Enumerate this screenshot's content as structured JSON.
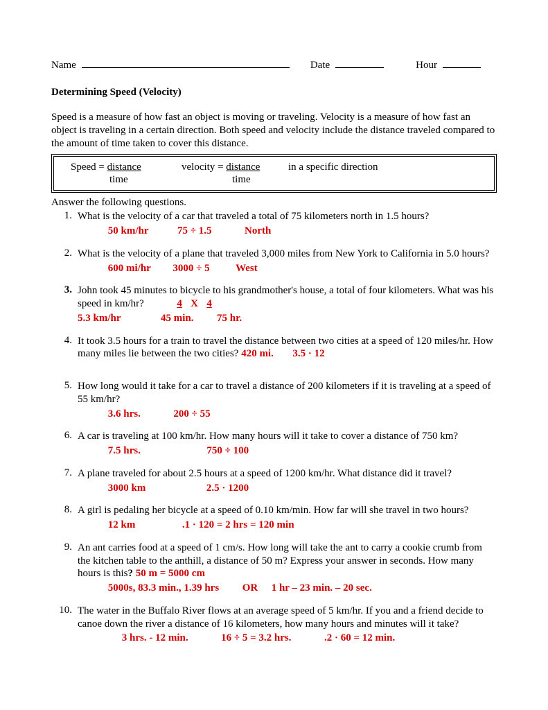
{
  "header": {
    "name_label": "Name",
    "date_label": "Date",
    "hour_label": "Hour"
  },
  "title": "Determining Speed (Velocity)",
  "intro": "Speed is a measure of how fast an object is moving or traveling.  Velocity is a measure of how fast an object is traveling in a certain direction.  Both speed and velocity include the distance traveled compared to the amount of time taken to cover this distance.",
  "formula": {
    "speed_label": "Speed = ",
    "speed_top": "distance",
    "speed_bot": "time",
    "vel_label": "velocity = ",
    "vel_top": "distance",
    "vel_bot": "time",
    "dir": "in a specific direction"
  },
  "answer_prompt": "Answer the following questions.",
  "q1": {
    "num": "1.",
    "text": "What is the velocity of a car that traveled a total of 75 kilometers north in 1.5 hours?",
    "a1": "50 km/hr",
    "a2": "75 ÷ 1.5",
    "a3": "North"
  },
  "q2": {
    "num": "2.",
    "text": "What is the velocity of a plane that traveled 3,000 miles from New York to California in 5.0 hours?",
    "a1": "600  mi/hr",
    "a2": "3000  ÷  5",
    "a3": "West"
  },
  "q3": {
    "num": "3.",
    "text1": "John took 45 minutes to bicycle to his grandmother's house, a total of four kilometers.  What was his speed in km/hr?",
    "a_top1": "4",
    "a_top2": "X",
    "a_top3": "4",
    "b1": "5.3 km/hr",
    "b2": "45 min.",
    "b3": "75 hr."
  },
  "q4": {
    "num": "4.",
    "text": "It took 3.5 hours for a train to travel the distance between two cities at a speed of 120 miles/hr.  How many miles lie between the two cities?",
    "a1": "420 mi.",
    "a2": "3.5  ·  12"
  },
  "q5": {
    "num": "5.",
    "text": "How long would it take for a car to travel a distance of 200 kilometers if it is traveling at a speed of 55 km/hr?",
    "a1": "3.6  hrs.",
    "a2": "200 ÷ 55"
  },
  "q6": {
    "num": "6.",
    "text": "A car is traveling at 100 km/hr.  How many hours will it take to cover a distance of 750 km?",
    "a1": "7.5 hrs.",
    "a2": "750 ÷ 100"
  },
  "q7": {
    "num": "7.",
    "text": "A plane traveled for about 2.5 hours at a speed of 1200 km/hr.  What distance did it travel?",
    "a1": "3000 km",
    "a2": "2.5  ·  1200"
  },
  "q8": {
    "num": "8.",
    "text": "A girl is pedaling her bicycle at a speed of 0.10 km/min.  How far will she travel in two hours?",
    "a1": "12 km",
    "a2": ".1  ·  120  =  2 hrs  =  120 min"
  },
  "q9": {
    "num": "9.",
    "text1": "An ant carries food at a speed of 1 cm/s.  How long will take the ant to carry a cookie crumb from the kitchen table to the anthill, a distance of 50 m?  Express your answer in seconds.  How many hours is this",
    "qm": "?  ",
    "a0": "50 m  =  5000 cm",
    "a1": "5000s,   83.3 min.,   1.39 hrs",
    "or": "OR",
    "a2": "1 hr – 23 min. – 20 sec."
  },
  "q10": {
    "num": "10.",
    "text": "The water in the Buffalo River flows at an average speed of 5 km/hr.  If you and a friend decide to canoe down the river a distance of 16 kilometers, how many hours and minutes will it take?",
    "a1": "3 hrs. - 12 min.",
    "a2": "16 ÷ 5 = 3.2 hrs.",
    "a3": ".2 · 60 = 12 min."
  }
}
